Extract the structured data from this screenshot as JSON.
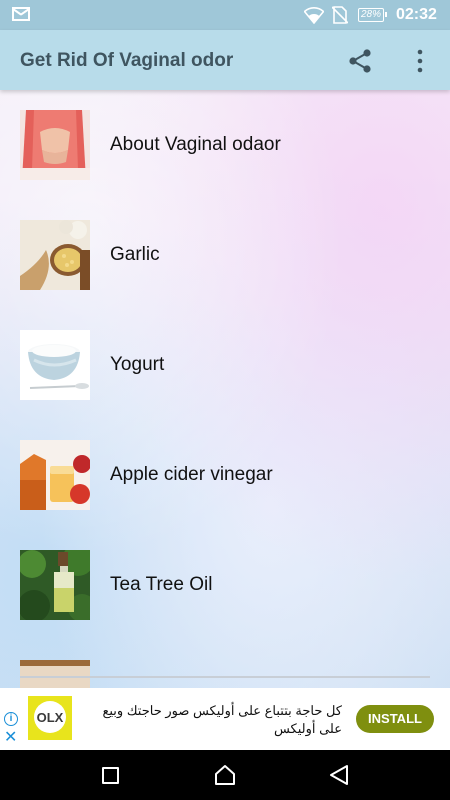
{
  "status_bar": {
    "battery": "28%",
    "time": "02:32"
  },
  "app_bar": {
    "title": "Get Rid Of Vaginal odor",
    "icons": [
      "share-icon",
      "more-vert-icon"
    ]
  },
  "items": [
    {
      "label": "About Vaginal odaor",
      "thumb": "woman-red-dress-image"
    },
    {
      "label": "Garlic",
      "thumb": "garlic-ginger-image"
    },
    {
      "label": "Yogurt",
      "thumb": "yogurt-bowl-image"
    },
    {
      "label": "Apple cider vinegar",
      "thumb": "apple-cider-vinegar-image"
    },
    {
      "label": "Tea Tree Oil",
      "thumb": "tea-tree-oil-image"
    }
  ],
  "ad": {
    "brand": "OLX",
    "text": "كل حاجة بتتباع على أوليكس صور حاجتك وبيع على أوليكس",
    "install_label": "INSTALL"
  },
  "colors": {
    "app_bar": "#b8dcea",
    "status_bar": "#9fc7d8",
    "install_button": "#7f8f0f"
  }
}
